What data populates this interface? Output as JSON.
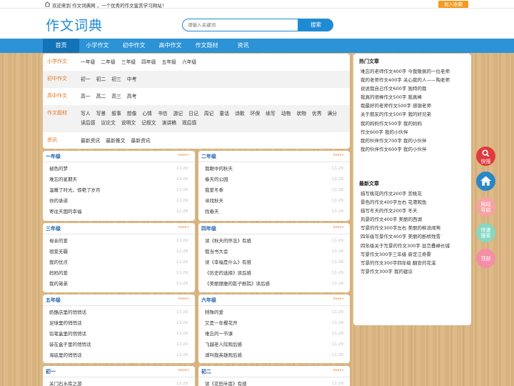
{
  "topbar": {
    "welcome": "欢迎来到 作文词典网 ，一个优秀的作文鉴赏学习网站！",
    "favorite": "加入收藏"
  },
  "header": {
    "logo": "作文词典",
    "search_placeholder": "请输入关键词",
    "search_button": "搜索"
  },
  "nav": [
    "首页",
    "小学作文",
    "初中作文",
    "高中作文",
    "作文题材",
    "资讯"
  ],
  "categories": [
    {
      "name": "小学作文",
      "links": [
        "一年级",
        "二年级",
        "三年级",
        "四年级",
        "五年级",
        "六年级"
      ]
    },
    {
      "name": "初中作文",
      "links": [
        "初一",
        "初二",
        "初三",
        "中考"
      ]
    },
    {
      "name": "高中作文",
      "links": [
        "高一",
        "高二",
        "高三",
        "高考"
      ]
    },
    {
      "name": "作文题材",
      "links": [
        "写人",
        "写景",
        "叙事",
        "想像",
        "心情",
        "书信",
        "游记",
        "日记",
        "周记",
        "童话",
        "诗歌",
        "环保",
        "续写",
        "动物",
        "状物",
        "优秀",
        "满分",
        "读后感",
        "议论文",
        "说明文",
        "记叙文",
        "演讲稿",
        "观后感"
      ]
    },
    {
      "name": "资讯",
      "links": [
        "最新资讯",
        "最新推文",
        "最新资讯"
      ]
    }
  ],
  "boxes": [
    {
      "title": "一年级",
      "more": "more+",
      "items": [
        "褪色的梦",
        "难忘的星期天",
        "温暖了时光，惊艳了岁月",
        "你的承诺",
        "寄往天国的幸福"
      ],
      "date": "11-29"
    },
    {
      "title": "二年级",
      "more": "more+",
      "items": [
        "我眼中的秋天",
        "春天的公园",
        "我爱冬季",
        "寻找秋天",
        "找春天"
      ],
      "date": "11-29"
    },
    {
      "title": "三年级",
      "more": "more+",
      "items": [
        "母亲的爱",
        "祖爱无疆",
        "我的优点",
        "妈妈的爱",
        "我的弟弟"
      ],
      "date": "11-29"
    },
    {
      "title": "四年级",
      "more": "more+",
      "items": [
        "读《秋天的怀念》有感",
        "我当书大会",
        "读《幸福是什么》有感",
        "《历史的选择》读后感",
        "《美丽丽雅的影子剧院》读后感"
      ],
      "date": "11-29"
    },
    {
      "title": "五年级",
      "more": "more+",
      "items": [
        "奶酪店里的悄悄话",
        "足球里的悄悄话",
        "铅笔盒里的悄悄话",
        "装在盒子里的悄悄话",
        "海底里的悄悄话"
      ],
      "date": "11-29"
    },
    {
      "title": "六年级",
      "more": "more+",
      "items": [
        "特殊的爱",
        "又是一年樱花开",
        "难忘的一节课",
        "飞越老人院观后感",
        "请叫我英雄观后感"
      ],
      "date": "11-29"
    },
    {
      "title": "初一",
      "more": "more+",
      "items": [
        "关门石水库之游"
      ],
      "date": "11-29"
    },
    {
      "title": "初二",
      "more": "more+",
      "items": [
        "读《花田半亩》有感"
      ],
      "date": "11-29"
    }
  ],
  "hot": {
    "title": "热门文章",
    "items": [
      "难忘的老师作文400字 今我敬佩的一位老师",
      "我的老师作文400字 关心我的人——陶老师",
      "说说我自己作文600字 独特的我",
      "我真的很棒作文500字 我真棒",
      "我最好的老师作文500字 感谢老师",
      "关于朋友的作文500字 我的好兄弟",
      "我的妈妈作文500字 我的妈妈",
      "作文600字 我的小伙伴",
      "我的伙伴作文700字 我的小伙伴",
      "我的伙伴作文600字 我的小伙伴"
    ]
  },
  "latest": {
    "title": "最新文章",
    "items": [
      "描写桃花的作文200字 赏桃花",
      "景色的作文400字左右 花港观鱼",
      "描写冬天的作文200字 冬天",
      "风景的作文400字 美丽的西湖",
      "写景的作文300字左右 美丽的柳浪闻莺",
      "四年级写景作文400字 美丽的断桥残雪",
      "四年级关于写景的作文300字 层峦叠嶂长城",
      "写景作文300字三年级 新定江奇雾",
      "写景的作文300字四年级 翻安的花溪",
      "写景作文300字 我的建议"
    ]
  },
  "side": [
    {
      "label": "快搜",
      "icon": "search-icon"
    },
    {
      "label": "",
      "icon": "home-icon"
    },
    {
      "label": "网站\n导航",
      "icon": ""
    },
    {
      "label": "快速\n搜索",
      "icon": ""
    },
    {
      "label": "顶部",
      "icon": ""
    }
  ],
  "colors": {
    "accent": "#1f8bd4",
    "nav": "#2b93d6",
    "nav_active": "#1273b8",
    "orange": "#e8721c",
    "side_red": "#e0393e",
    "side_blue": "#2a87c6",
    "side_pink": "#f7a1a4",
    "side_green": "#86d8c2",
    "side_rose": "#f58ea6"
  }
}
